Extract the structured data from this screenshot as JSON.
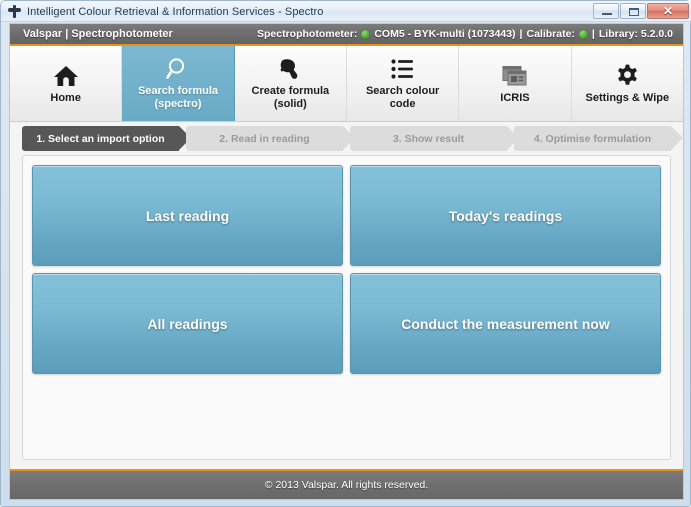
{
  "window": {
    "title": "Intelligent Colour Retrieval & Information Services - Spectro",
    "app_icon": "app-logo-icon",
    "controls": {
      "minimize": "minimize-icon",
      "maximize": "maximize-icon",
      "close": "✕"
    }
  },
  "statusbar": {
    "brand": "Valspar | Spectrophotometer",
    "device_label": "Spectrophotometer:",
    "device_value": "COM5 - BYK-multi (1073443)",
    "separator1": "|",
    "calibrate_label": "Calibrate:",
    "separator2": "|",
    "library_label": "Library: 5.2.0.0",
    "device_led_color": "#4aa832",
    "calibrate_led_color": "#4aa832",
    "accent_color": "#e8921e"
  },
  "nav": {
    "items": [
      {
        "id": "home",
        "label": "Home",
        "icon": "home-icon",
        "active": false
      },
      {
        "id": "search-formula-spectro",
        "label": "Search formula\n(spectro)",
        "icon": "magnifier-icon",
        "active": true
      },
      {
        "id": "create-formula-solid",
        "label": "Create formula\n(solid)",
        "icon": "paint-icon",
        "active": false
      },
      {
        "id": "search-colour-code",
        "label": "Search colour\ncode",
        "icon": "list-icon",
        "active": false
      },
      {
        "id": "icris",
        "label": "ICRIS",
        "icon": "window-card-icon",
        "active": false
      },
      {
        "id": "settings-wipe",
        "label": "Settings & Wipe",
        "icon": "gear-icon",
        "active": false
      }
    ]
  },
  "steps": [
    {
      "label": "1. Select an import option",
      "active": true
    },
    {
      "label": "2. Read in reading",
      "active": false
    },
    {
      "label": "3. Show result",
      "active": false
    },
    {
      "label": "4. Optimise formulation",
      "active": false
    }
  ],
  "tiles": [
    {
      "id": "last-reading",
      "label": "Last reading"
    },
    {
      "id": "todays-readings",
      "label": "Today's readings"
    },
    {
      "id": "all-readings",
      "label": "All readings"
    },
    {
      "id": "conduct-measurement-now",
      "label": "Conduct the measurement now"
    }
  ],
  "footer": {
    "copyright": "© 2013 Valspar. All rights reserved."
  }
}
